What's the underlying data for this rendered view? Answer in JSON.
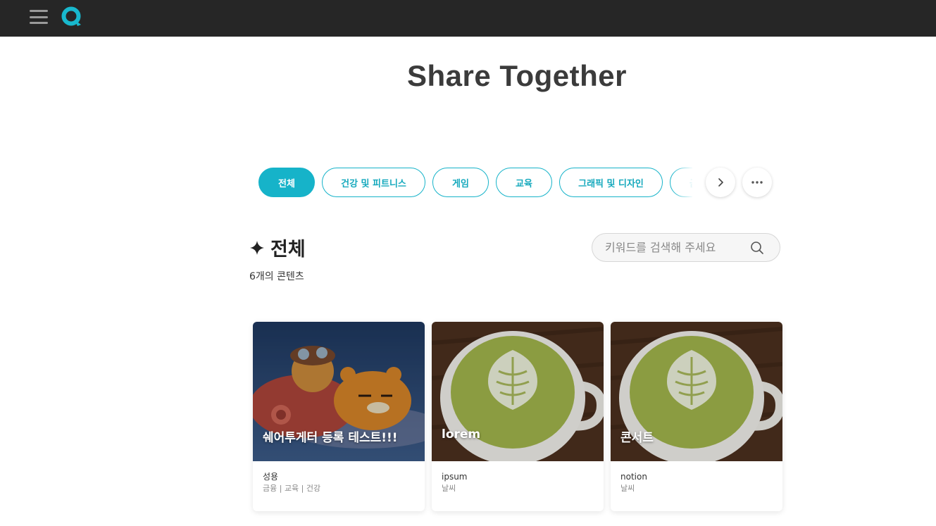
{
  "header": {
    "menu_icon": "hamburger-menu-icon",
    "logo_icon": "q-logo-icon",
    "brand_color": "#18b8cd"
  },
  "page": {
    "title": "Share Together"
  },
  "categories": {
    "items": [
      {
        "label": "전체",
        "active": true
      },
      {
        "label": "건강 및 피트니스",
        "active": false
      },
      {
        "label": "게임",
        "active": false
      },
      {
        "label": "교육",
        "active": false
      },
      {
        "label": "그래픽 및 디자인",
        "active": false
      },
      {
        "label": "금융",
        "active": false
      }
    ],
    "next_icon": "chevron-right-icon",
    "more_icon": "more-horizontal-icon"
  },
  "section": {
    "title": "전체",
    "icon": "sparkle-icon",
    "count_text": "6개의 콘텐츠"
  },
  "search": {
    "placeholder": "키워드를 검색해 주세요",
    "value": "",
    "icon": "search-icon"
  },
  "cards": [
    {
      "title": "쉐어투게터 등록 테스트!!!",
      "name": "성용",
      "tags": "금융 | 교육 | 건강",
      "image": "ryan-airplane-illustration"
    },
    {
      "title": "lorem",
      "name": "ipsum",
      "tags": "날씨",
      "image": "matcha-latte-photo"
    },
    {
      "title": "콘서트",
      "name": "notion",
      "tags": "날씨",
      "image": "matcha-latte-photo"
    }
  ]
}
